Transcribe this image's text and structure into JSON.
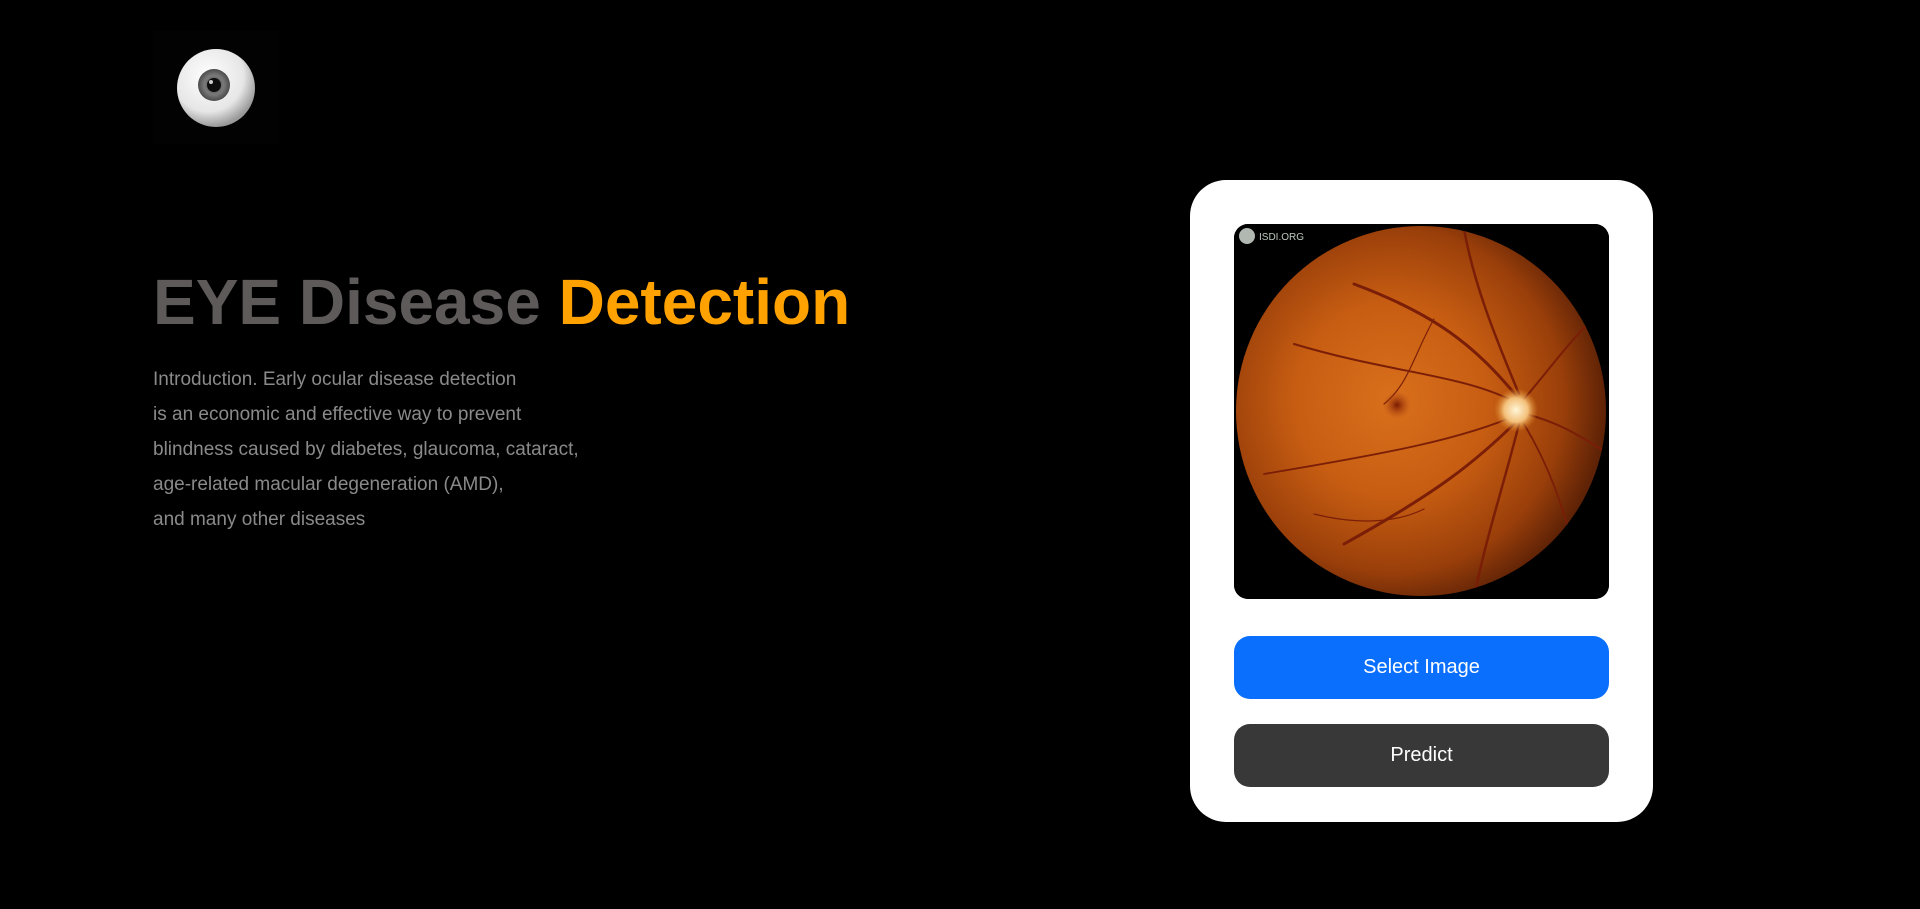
{
  "logo": {
    "icon": "eyeball-icon"
  },
  "hero": {
    "title_part1": "EYE Disease",
    "title_part2": "Detection",
    "intro_lines": [
      "Introduction. Early ocular disease detection",
      "is an economic and effective way to prevent",
      "blindness caused by diabetes, glaucoma, cataract,",
      "age-related macular degeneration (AMD),",
      "and many other diseases"
    ]
  },
  "uploader": {
    "preview_watermark": "ISDI.ORG",
    "select_label": "Select Image",
    "predict_label": "Predict"
  },
  "colors": {
    "background": "#000000",
    "title_gray": "#5e5a5a",
    "title_accent": "#ffa200",
    "intro_text": "#8a8a8a",
    "select_button": "#0a6ffd",
    "predict_button": "#383838",
    "card": "#ffffff"
  }
}
